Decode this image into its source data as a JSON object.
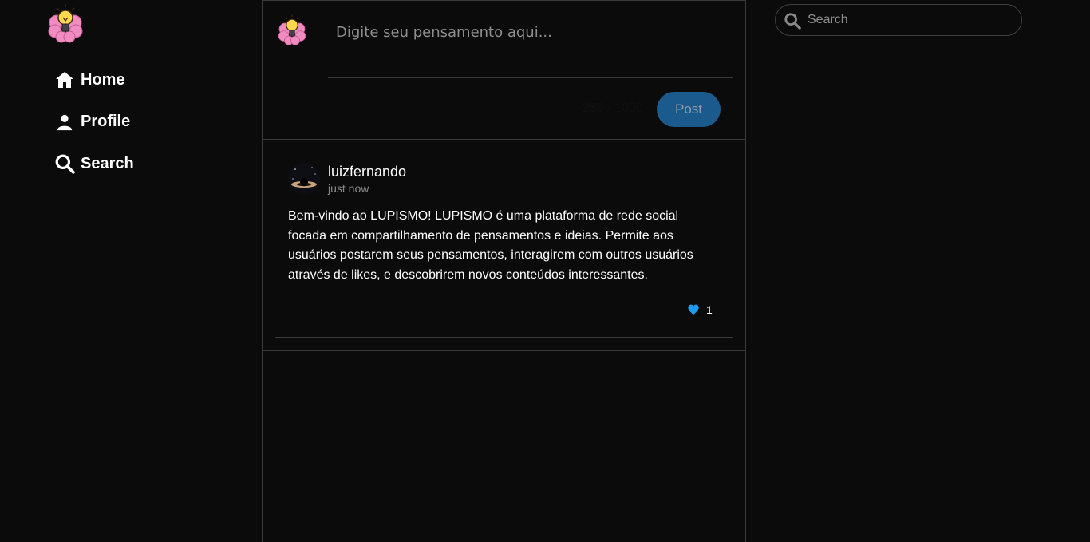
{
  "sidebar": {
    "items": [
      {
        "label": "Home",
        "icon": "home-icon"
      },
      {
        "label": "Profile",
        "icon": "user-icon"
      },
      {
        "label": "Search",
        "icon": "search-icon"
      }
    ]
  },
  "composer": {
    "placeholder": "Digite seu pensamento aqui...",
    "char_count": "259 / 1000",
    "post_label": "Post"
  },
  "post": {
    "username": "luizfernando",
    "time": "just now",
    "body": "Bem-vindo ao LUPISMO! LUPISMO é uma plataforma de rede social focada em compartilhamento de pensamentos e ideias. Permite aos usuários postarem seus pensamentos, interagirem com outros usuários através de likes, e descobrirem novos conteúdos interessantes.",
    "likes": "1"
  },
  "search": {
    "placeholder": "Search"
  },
  "colors": {
    "background": "#0b0b0b",
    "accent": "#1a5a8c",
    "like": "#1d9bf0",
    "border": "#3a3a3a"
  }
}
